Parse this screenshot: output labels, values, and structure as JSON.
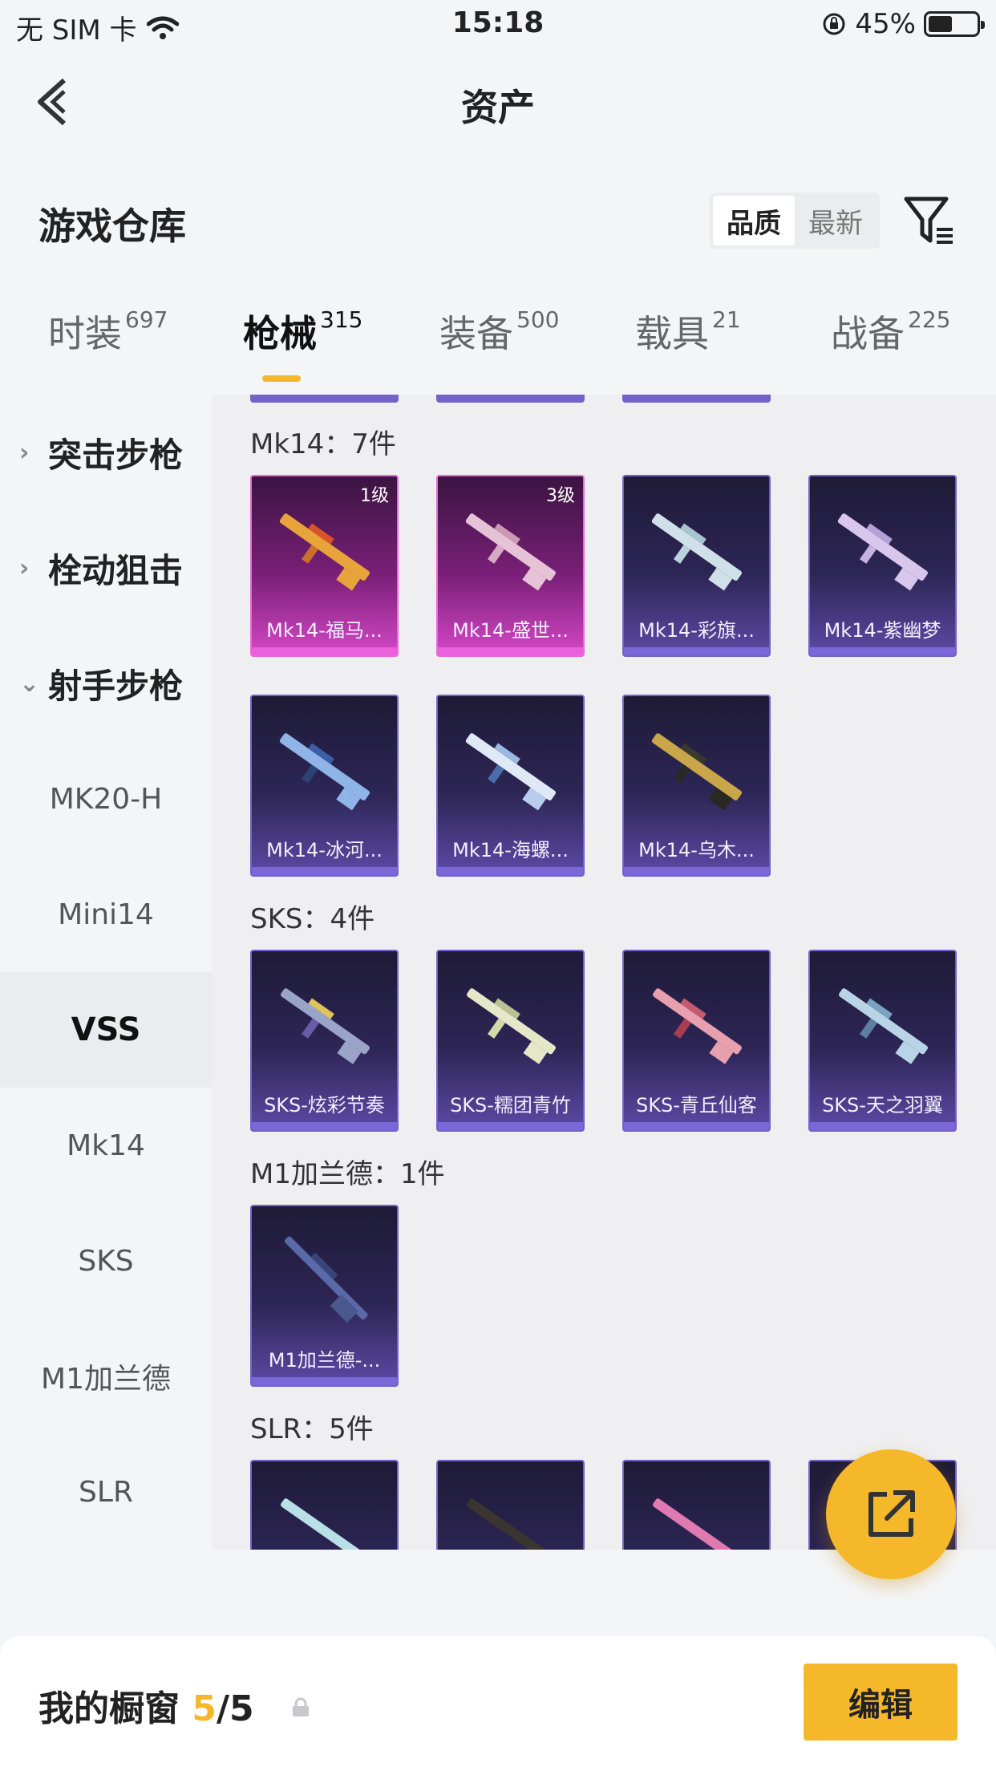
{
  "status_bar": {
    "carrier": "无 SIM 卡",
    "time": "15:18",
    "battery": "45%",
    "battery_level": 0.45
  },
  "nav": {
    "title": "资产"
  },
  "warehouse": {
    "title": "游戏仓库",
    "sort_quality": "品质",
    "sort_latest": "最新"
  },
  "tabs": [
    {
      "label": "时装",
      "count": "697"
    },
    {
      "label": "枪械",
      "count": "315"
    },
    {
      "label": "装备",
      "count": "500"
    },
    {
      "label": "载具",
      "count": "21"
    },
    {
      "label": "战备",
      "count": "225"
    }
  ],
  "sidebar": {
    "groups": [
      "突击步枪",
      "栓动狙击",
      "射手步枪"
    ],
    "subs": [
      "MK20-H",
      "Mini14",
      "VSS",
      "Mk14",
      "SKS",
      "M1加兰德",
      "SLR"
    ]
  },
  "sections": [
    {
      "header": "Mk14：7件"
    },
    {
      "header": "SKS：4件"
    },
    {
      "header": "M1加兰德：1件"
    },
    {
      "header": "SLR：5件"
    }
  ],
  "items": {
    "mk14": [
      {
        "name": "Mk14-福马...",
        "level": "1级"
      },
      {
        "name": "Mk14-盛世...",
        "level": "3级"
      },
      {
        "name": "Mk14-彩旗..."
      },
      {
        "name": "Mk14-紫幽梦"
      },
      {
        "name": "Mk14-冰河..."
      },
      {
        "name": "Mk14-海螺..."
      },
      {
        "name": "Mk14-乌木..."
      }
    ],
    "sks": [
      {
        "name": "SKS-炫彩节奏"
      },
      {
        "name": "SKS-糯团青竹"
      },
      {
        "name": "SKS-青丘仙客"
      },
      {
        "name": "SKS-天之羽翼"
      }
    ],
    "m1": [
      {
        "name": "M1加兰德-..."
      }
    ]
  },
  "showcase": {
    "label": "我的橱窗",
    "current": "5",
    "total": "/5",
    "edit": "编辑"
  },
  "colors": {
    "accent": "#f5b82b",
    "card_purple": "#7462c8",
    "card_pink": "#e86ad8"
  }
}
